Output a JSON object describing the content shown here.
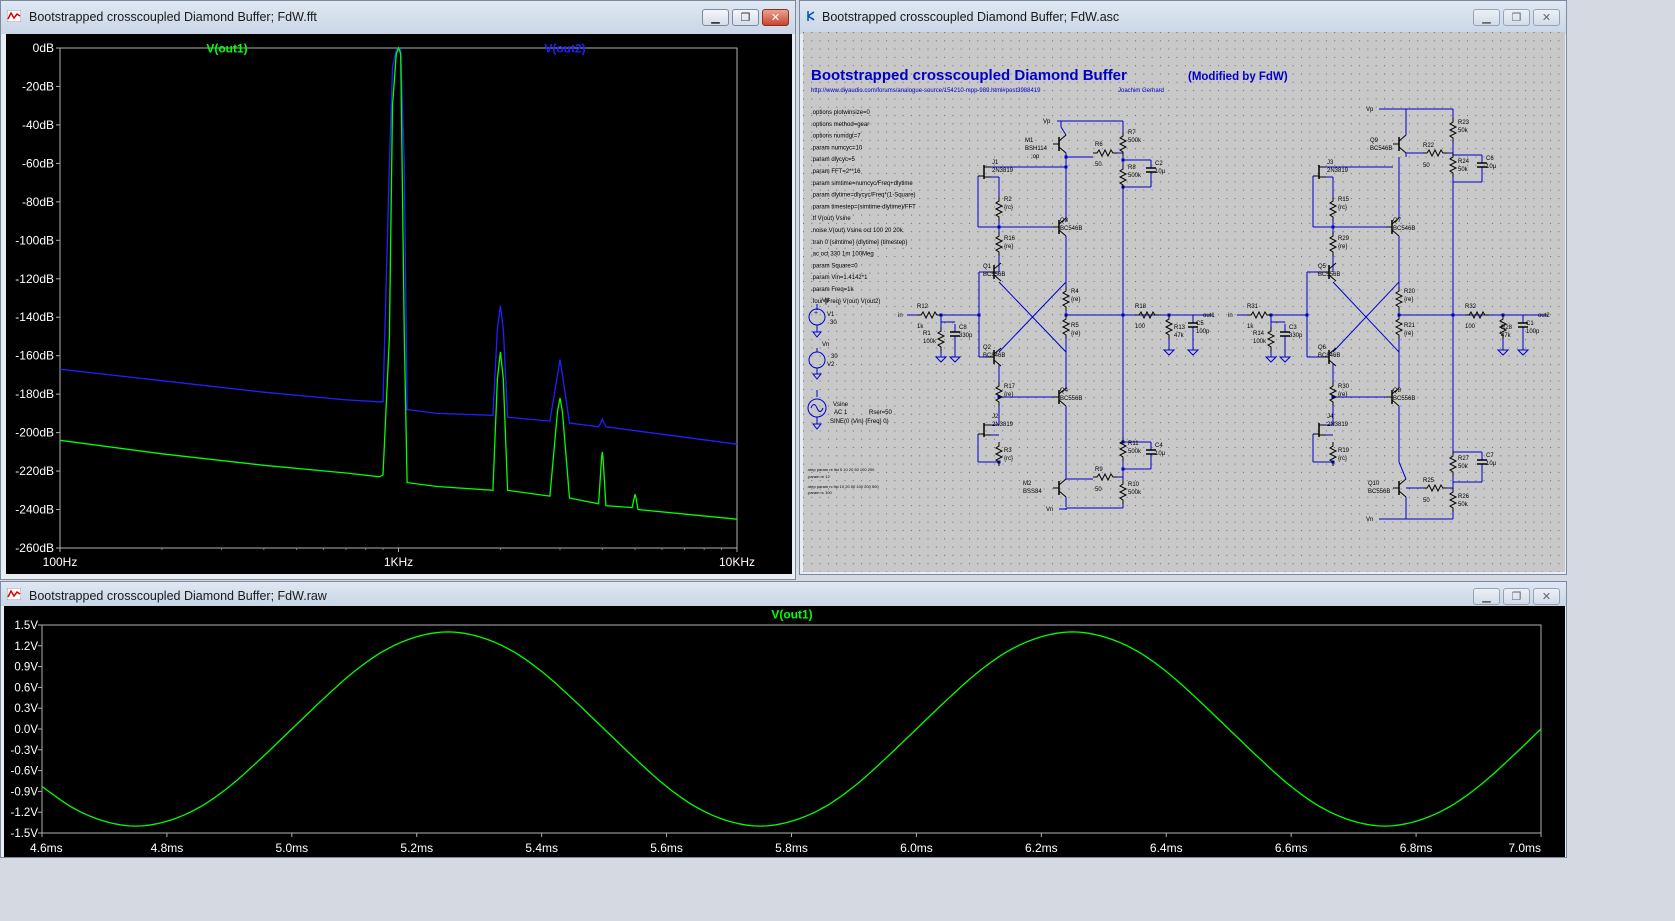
{
  "fft_window": {
    "title": "Bootstrapped crosscoupled Diamond Buffer; FdW.fft",
    "trace_labels": [
      "V(out1)",
      "V(out2)"
    ],
    "y_ticks": [
      "0dB",
      "-20dB",
      "-40dB",
      "-60dB",
      "-80dB",
      "-100dB",
      "-120dB",
      "-140dB",
      "-160dB",
      "-180dB",
      "-200dB",
      "-220dB",
      "-240dB",
      "-260dB"
    ],
    "x_ticks": [
      "100Hz",
      "1KHz",
      "10KHz"
    ]
  },
  "schematic_window": {
    "title": "Bootstrapped crosscoupled Diamond Buffer; FdW.asc",
    "heading": "Bootstrapped crosscoupled Diamond Buffer",
    "subheading": "(Modified by FdW)",
    "url": "http://www.diyaudio.com/forums/analogue-source/154210-mpp-989.html#post3988419",
    "author": "Joachim Gerhard",
    "directives": [
      ".options plotwinsize=0",
      ".options method=gear",
      ".options numdgt=7",
      ".param numcyc=10",
      ".param dlycyc=5",
      ".param FFT=2**16",
      ".param simtime=numcyc/Freq+dlytime",
      ".param dlytime=dlycyc/Freq*(1-Square)",
      ".param timestep=(simtime-dlytime)/FFT",
      ".tf V(out) Vsine",
      ".noise V(out) Vsine oct 100 20 20k",
      ".tran 0 {simtime} {dlytime} {timestep}",
      ".ac oct 330 1m 100Meg",
      ".param Square=0",
      ".param Vin=1.4142*1",
      ".param Freq=1k",
      ".four {Freq} V(out) V(out2)"
    ],
    "op_directive": ";op",
    "step_notes": [
      ".step param re list 5 10 20 50 100 200",
      ".param re 12",
      ".step param rc list 10 20 50 100 200 500",
      ".param rc 100"
    ],
    "sources": [
      {
        "name": "V1",
        "value": "30",
        "node": "Vp"
      },
      {
        "name": "V2",
        "value": "30",
        "node": "Vn"
      }
    ],
    "vsine": {
      "name": "Vsine",
      "ac": "AC 1",
      "sine": "SINE(0 {Vin} {Freq} 0)",
      "rser": "Rser=50"
    },
    "parts": {
      "M1": "M1",
      "M1v": "BSH114",
      "M2": "M2",
      "M2v": "BSS84",
      "J1": "J1",
      "J1v": "2N3819",
      "J2": "J2",
      "J2v": "2N3819",
      "Q1": "Q1",
      "Q1v": "BC556B",
      "Q2": "Q2",
      "Q2v": "BC846B",
      "Q3": "Q3",
      "Q3v": "BC546B",
      "Q4": "Q4",
      "Q4v": "BC556B",
      "R1": "R1",
      "R1v": "100k",
      "R2": "R2",
      "R2v": "{rc}",
      "R3": "R3",
      "R3v": "{rc}",
      "R4": "R4",
      "R4v": "{re}",
      "R5": "R5",
      "R5v": "{re}",
      "R6": "R6",
      "R6v": "50",
      "R7": "R7",
      "R7v": "500k",
      "R8": "R8",
      "R8v": "500k",
      "R9": "R9",
      "R9v": "50",
      "R10": "R10",
      "R10v": "500k",
      "R11": "R11",
      "R11v": "500k",
      "R12": "R12",
      "R12v": "1k",
      "R13": "R13",
      "R13v": "47k",
      "R16": "R16",
      "R16v": "{re}",
      "R17": "R17",
      "R17v": "{re}",
      "R18": "R18",
      "R18v": "100",
      "C2": "C2",
      "C2v": "10µ",
      "C4": "C4",
      "C4v": "10µ",
      "C5": "C5",
      "C5v": "100p",
      "C8": "C8",
      "C8v": "330p",
      "M3": "Q9",
      "M3v": "BC546B",
      "Q10": "Q10",
      "Q10v": "BC556B",
      "J3": "J3",
      "J3v": "2N3819",
      "J4": "J4",
      "J4v": "2N3819",
      "Q5": "Q5",
      "Q5v": "BC556B",
      "Q6": "Q6",
      "Q6v": "BC846B",
      "Q7": "Q7",
      "Q7v": "BC546B",
      "Q8": "Q8",
      "Q8v": "BC556B",
      "R14": "R14",
      "R14v": "100k",
      "R15": "R15",
      "R15v": "{rc}",
      "R19": "R19",
      "R19v": "{rc}",
      "R20": "R20",
      "R20v": "{re}",
      "R21": "R21",
      "R21v": "{re}",
      "R22": "R22",
      "R22v": "50",
      "R23": "R23",
      "R23v": "50k",
      "R24": "R24",
      "R24v": "50k",
      "R25": "R25",
      "R25v": "50",
      "R26": "R26",
      "R26v": "50k",
      "R27": "R27",
      "R27v": "50k",
      "R28": "R28",
      "R28v": "47k",
      "R29": "R29",
      "R29v": "{re}",
      "R30": "R30",
      "R30v": "{re}",
      "R31": "R31",
      "R31v": "1k",
      "R32": "R32",
      "R32v": "100",
      "C1": "C1",
      "C1v": "100p",
      "C3": "C3",
      "C3v": "330p",
      "C6": "C6",
      "C6v": "10µ",
      "C7": "C7",
      "C7v": "10µ"
    },
    "nets": {
      "vp": "Vp",
      "vn": "Vn",
      "in": "in",
      "out1": "out1",
      "out2": "out2"
    }
  },
  "raw_window": {
    "title": "Bootstrapped crosscoupled Diamond Buffer; FdW.raw",
    "trace_label": "V(out1)",
    "y_ticks": [
      "1.5V",
      "1.2V",
      "0.9V",
      "0.6V",
      "0.3V",
      "0.0V",
      "-0.3V",
      "-0.6V",
      "-0.9V",
      "-1.2V",
      "-1.5V"
    ],
    "x_ticks": [
      "4.6ms",
      "4.8ms",
      "5.0ms",
      "5.2ms",
      "5.4ms",
      "5.6ms",
      "5.8ms",
      "6.0ms",
      "6.2ms",
      "6.4ms",
      "6.6ms",
      "6.8ms",
      "7.0ms"
    ]
  },
  "colors": {
    "trace_green": "#00ff00",
    "trace_blue": "#2020ff",
    "schematic_blue": "#0000cc",
    "plot_bg": "#000000"
  },
  "chart_data": [
    {
      "type": "line",
      "title": "",
      "xlabel": "",
      "ylabel": "",
      "x_scale": "log",
      "xlim": [
        100,
        10000
      ],
      "ylim": [
        -260,
        0
      ],
      "series": [
        {
          "name": "V(out1)",
          "color": "#00ff00",
          "x": [
            100,
            200,
            400,
            700,
            880,
            900,
            940,
            960,
            985,
            1000,
            1015,
            1040,
            1060,
            1300,
            1900,
            1960,
            2000,
            2040,
            2100,
            2800,
            2950,
            3000,
            3050,
            3200,
            3900,
            3980,
            4000,
            4020,
            4100,
            4900,
            4970,
            5000,
            5030,
            5100,
            10000
          ],
          "y": [
            -204,
            -211,
            -217,
            -221,
            -223,
            -222,
            -150,
            -30,
            -3,
            0,
            -3,
            -150,
            -226,
            -228,
            -230,
            -172,
            -158,
            -172,
            -230,
            -233,
            -189,
            -182,
            -189,
            -234,
            -237,
            -213,
            -210,
            -213,
            -238,
            -239,
            -234,
            -232,
            -234,
            -240,
            -245
          ]
        },
        {
          "name": "V(out2)",
          "color": "#2020ff",
          "x": [
            100,
            200,
            400,
            700,
            880,
            900,
            940,
            960,
            985,
            1000,
            1015,
            1040,
            1060,
            1300,
            1900,
            1960,
            2000,
            2040,
            2100,
            2800,
            2950,
            3000,
            3050,
            3200,
            3900,
            3980,
            4000,
            4020,
            4100,
            10000
          ],
          "y": [
            -167,
            -173,
            -179,
            -183,
            -184,
            -184,
            -60,
            -10,
            -1,
            0,
            -1,
            -60,
            -188,
            -190,
            -191,
            -146,
            -134,
            -146,
            -192,
            -194,
            -170,
            -162,
            -170,
            -195,
            -197,
            -194,
            -193,
            -194,
            -197,
            -206
          ]
        }
      ]
    },
    {
      "type": "line",
      "title": "",
      "xlabel": "",
      "ylabel": "",
      "xlim": [
        4.6,
        7.0
      ],
      "ylim": [
        -1.5,
        1.5
      ],
      "series": [
        {
          "name": "V(out1)",
          "color": "#00ff00",
          "x": [
            4.6,
            4.65,
            4.7,
            4.75,
            4.8,
            4.85,
            4.9,
            4.95,
            5.0,
            5.05,
            5.1,
            5.15,
            5.2,
            5.25,
            5.3,
            5.35,
            5.4,
            5.45,
            5.5,
            5.55,
            5.6,
            5.65,
            5.7,
            5.75,
            5.8,
            5.85,
            5.9,
            5.95,
            6.0,
            6.05,
            6.1,
            6.15,
            6.2,
            6.25,
            6.3,
            6.35,
            6.4,
            6.45,
            6.5,
            6.55,
            6.6,
            6.65,
            6.7,
            6.75,
            6.8,
            6.85,
            6.9,
            6.95,
            7.0
          ],
          "y": [
            -0.83,
            -1.14,
            -1.33,
            -1.4,
            -1.33,
            -1.14,
            -0.83,
            -0.43,
            0.0,
            0.43,
            0.83,
            1.14,
            1.33,
            1.4,
            1.33,
            1.14,
            0.83,
            0.43,
            0.0,
            -0.43,
            -0.83,
            -1.14,
            -1.33,
            -1.4,
            -1.33,
            -1.14,
            -0.83,
            -0.43,
            0.0,
            0.43,
            0.83,
            1.14,
            1.33,
            1.4,
            1.33,
            1.14,
            0.83,
            0.43,
            0.0,
            -0.43,
            -0.83,
            -1.14,
            -1.33,
            -1.4,
            -1.33,
            -1.14,
            -0.83,
            -0.43,
            0.0
          ]
        }
      ]
    }
  ]
}
